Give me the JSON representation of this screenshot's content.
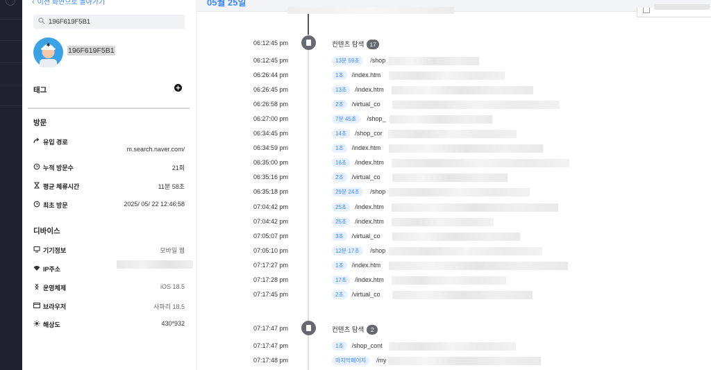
{
  "panel": {
    "back_label": "이전 화면으로 돌아가기",
    "search_value": "196F619F5B1",
    "profile_id": "196F619F5B1",
    "tag_title": "태그",
    "visit_title": "방문",
    "visit_rows": [
      {
        "label": "유입 경로",
        "value": "m.search.naver.com/",
        "icon": "redirect-icon"
      },
      {
        "label": "누적 방문수",
        "value": "21회",
        "icon": "history-icon"
      },
      {
        "label": "평균 체류시간",
        "value": "11분 58초",
        "icon": "hourglass-icon"
      },
      {
        "label": "최초 방문",
        "value": "2025/ 05/ 22 12:46:58",
        "icon": "history-icon"
      }
    ],
    "device_title": "디바이스",
    "device_rows": [
      {
        "label": "기기정보",
        "value": "모바일 웹",
        "icon": "monitor-icon"
      },
      {
        "label": "IP주소",
        "value": "",
        "icon": "wifi-icon"
      },
      {
        "label": "운영체제",
        "value": "iOS 18.5",
        "icon": "os-icon"
      },
      {
        "label": "브라우저",
        "value": "사파리 18.5",
        "icon": "browser-icon"
      },
      {
        "label": "해상도",
        "value": "430*932",
        "icon": "sun-icon"
      }
    ]
  },
  "main": {
    "date_header": "05월 25일",
    "groups": [
      {
        "time": "06:12:45 pm",
        "title": "컨텐츠 탐색",
        "count": "17",
        "events": [
          {
            "time": "06:12:45 pm",
            "duration": "13분 59초",
            "path": "/shop"
          },
          {
            "time": "06:26:44 pm",
            "duration": "1초",
            "path": "/index.htm"
          },
          {
            "time": "06:26:45 pm",
            "duration": "13초",
            "path": "/index.htm"
          },
          {
            "time": "06:26:58 pm",
            "duration": "2초",
            "path": "/virtual_co"
          },
          {
            "time": "06:27:00 pm",
            "duration": "7분 45초",
            "path": "/shop_"
          },
          {
            "time": "06:34:45 pm",
            "duration": "14초",
            "path": "/shop_cor"
          },
          {
            "time": "06:34:59 pm",
            "duration": "1초",
            "path": "/index.htm"
          },
          {
            "time": "06:35:00 pm",
            "duration": "16초",
            "path": "/index.htm"
          },
          {
            "time": "06:35:16 pm",
            "duration": "2초",
            "path": "/virtual_co"
          },
          {
            "time": "06:35:18 pm",
            "duration": "29분 24초",
            "path": "/shop"
          },
          {
            "time": "07:04:42 pm",
            "duration": "25초",
            "path": "/index.htm"
          },
          {
            "time": "07:04:42 pm",
            "duration": "25초",
            "path": "/index.htm"
          },
          {
            "time": "07:05:07 pm",
            "duration": "3초",
            "path": "/virtual_co"
          },
          {
            "time": "07:05:10 pm",
            "duration": "12분 17초",
            "path": "/shop"
          },
          {
            "time": "07:17:27 pm",
            "duration": "1초",
            "path": "/index.htm"
          },
          {
            "time": "07:17:28 pm",
            "duration": "17초",
            "path": "/index.htm"
          },
          {
            "time": "07:17:45 pm",
            "duration": "2초",
            "path": "/virtual_co"
          }
        ]
      },
      {
        "time": "07:17:47 pm",
        "title": "컨텐츠 탐색",
        "count": "2",
        "events": [
          {
            "time": "07:17:47 pm",
            "duration": "1초",
            "path": "/shop_cont"
          },
          {
            "time": "07:17:48 pm",
            "duration": "마지막페이지",
            "path": "/my"
          }
        ]
      }
    ]
  },
  "colors": {
    "accent": "#3a86ff",
    "badge_bg": "#e8f1ff",
    "node": "#666a70"
  }
}
